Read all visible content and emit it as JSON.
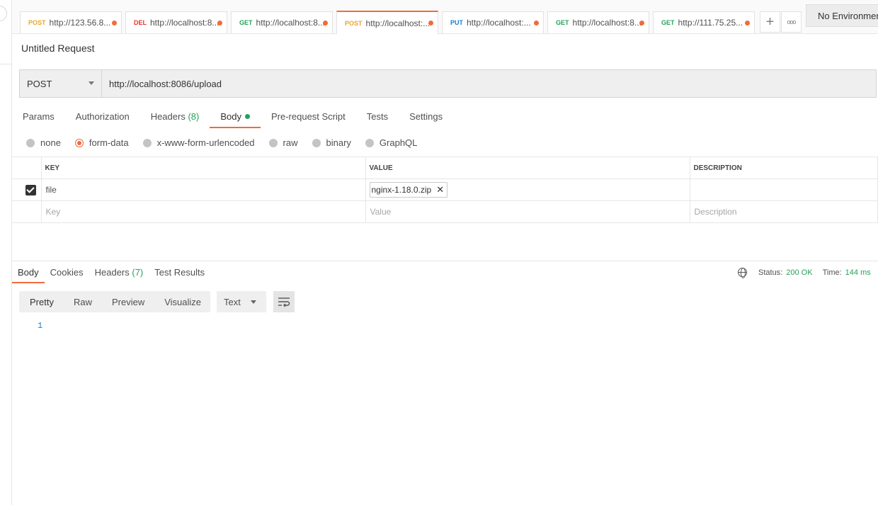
{
  "tabs": [
    {
      "method": "POST",
      "url": "http://123.56.8...",
      "method_class": "m-post"
    },
    {
      "method": "DEL",
      "url": "http://localhost:8...",
      "method_class": "m-del"
    },
    {
      "method": "GET",
      "url": "http://localhost:8...",
      "method_class": "m-get"
    },
    {
      "method": "POST",
      "url": "http://localhost:...",
      "method_class": "m-post"
    },
    {
      "method": "PUT",
      "url": "http://localhost:...",
      "method_class": "m-put"
    },
    {
      "method": "GET",
      "url": "http://localhost:8...",
      "method_class": "m-get"
    },
    {
      "method": "GET",
      "url": "http://111.75.25...",
      "method_class": "m-get"
    }
  ],
  "tab_buttons": {
    "add": "+",
    "more": "ooo"
  },
  "environment": "No Environment",
  "request_title": "Untitled Request",
  "request": {
    "method": "POST",
    "url": "http://localhost:8086/upload"
  },
  "request_tabs": {
    "params": "Params",
    "authorization": "Authorization",
    "headers": "Headers",
    "headers_count": "(8)",
    "body": "Body",
    "prerequest": "Pre-request Script",
    "tests": "Tests",
    "settings": "Settings"
  },
  "body_types": {
    "none": "none",
    "form_data": "form-data",
    "urlencoded": "x-www-form-urlencoded",
    "raw": "raw",
    "binary": "binary",
    "graphql": "GraphQL"
  },
  "params_table": {
    "headers": {
      "key": "KEY",
      "value": "VALUE",
      "description": "DESCRIPTION"
    },
    "row": {
      "key": "file",
      "value": "nginx-1.18.0.zip"
    },
    "placeholders": {
      "key": "Key",
      "value": "Value",
      "description": "Description"
    }
  },
  "response_tabs": {
    "body": "Body",
    "cookies": "Cookies",
    "headers": "Headers",
    "headers_count": "(7)",
    "tests": "Test Results"
  },
  "response_meta": {
    "status_label": "Status:",
    "status_value": "200 OK",
    "time_label": "Time:",
    "time_value": "144 ms"
  },
  "view_modes": {
    "pretty": "Pretty",
    "raw": "Raw",
    "preview": "Preview",
    "visualize": "Visualize"
  },
  "format": "Text",
  "response_line": "1",
  "colors": {
    "accent": "#f26b3a",
    "success": "#27a05a"
  }
}
